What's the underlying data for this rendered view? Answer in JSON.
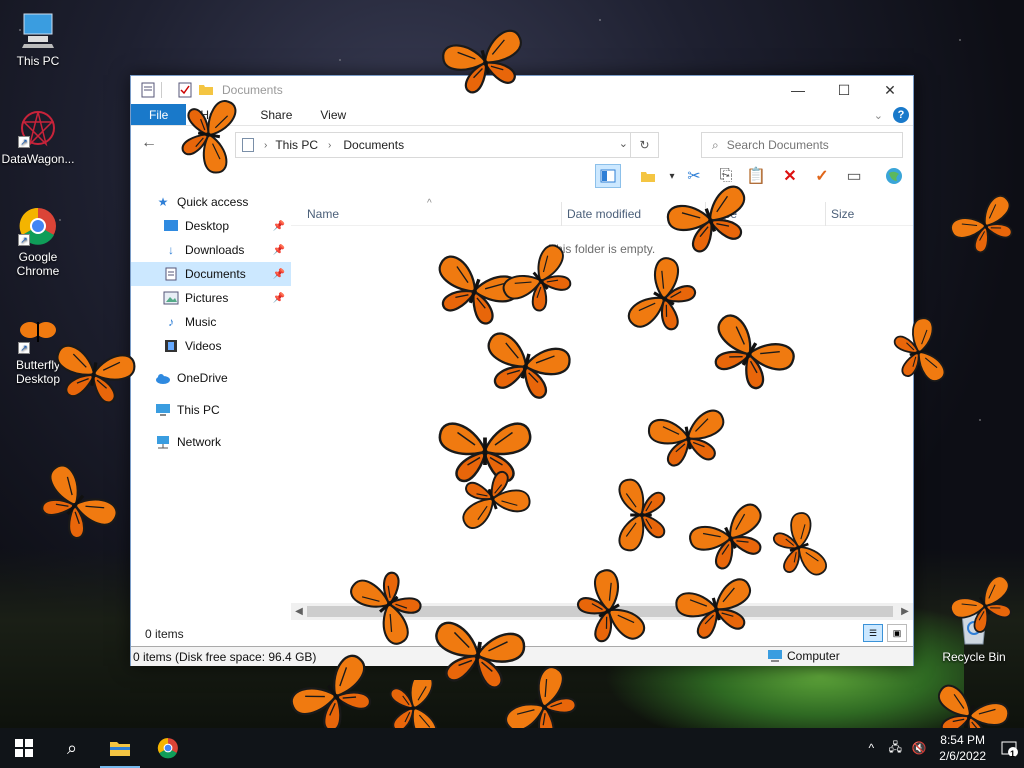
{
  "desktop": {
    "icons": [
      {
        "label": "This PC",
        "icon": "computer-icon"
      },
      {
        "label": "DataWagon...",
        "icon": "datawagon-icon"
      },
      {
        "label": "Google Chrome",
        "icon": "chrome-icon"
      },
      {
        "label": "Butterfly Desktop",
        "icon": "butterfly-icon"
      },
      {
        "label": "Recycle Bin",
        "icon": "recycle-bin-icon"
      }
    ]
  },
  "explorer": {
    "title": "Documents",
    "ribbon_tabs": [
      "File",
      "Home",
      "Share",
      "View"
    ],
    "address": {
      "crumbs": [
        "This PC",
        "Documents"
      ]
    },
    "search": {
      "placeholder": "Search Documents"
    },
    "nav": [
      {
        "label": "Quick access",
        "icon": "star-icon"
      },
      {
        "label": "Desktop",
        "icon": "desktop-folder-icon",
        "pinned": true
      },
      {
        "label": "Downloads",
        "icon": "download-icon",
        "pinned": true
      },
      {
        "label": "Documents",
        "icon": "documents-icon",
        "pinned": true,
        "selected": true
      },
      {
        "label": "Pictures",
        "icon": "pictures-icon",
        "pinned": true
      },
      {
        "label": "Music",
        "icon": "music-icon"
      },
      {
        "label": "Videos",
        "icon": "videos-icon"
      },
      {
        "label": "OneDrive",
        "icon": "cloud-icon"
      },
      {
        "label": "This PC",
        "icon": "computer-icon"
      },
      {
        "label": "Network",
        "icon": "network-icon"
      }
    ],
    "columns": [
      "Name",
      "Date modified",
      "Type",
      "Size"
    ],
    "empty_message": "This folder is empty.",
    "status_items": "0 items",
    "status_bar": "0 items (Disk free space: 96.4 GB)",
    "status_location": "Computer"
  },
  "taskbar": {
    "time": "8:54 PM",
    "date": "2/6/2022",
    "notification_count": "1"
  },
  "colors": {
    "accent": "#1979ca",
    "selection": "#cce8ff",
    "butterfly": "#f07a10"
  }
}
